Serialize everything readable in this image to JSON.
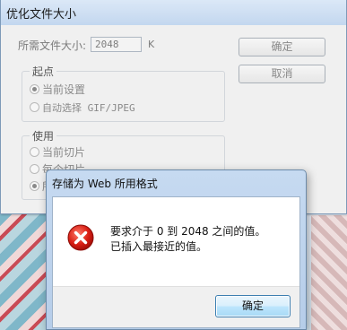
{
  "main_dialog": {
    "title": "优化文件大小",
    "size_label": "所需文件大小:",
    "size_value": "2048",
    "size_unit": "K",
    "ok_label": "确定",
    "cancel_label": "取消",
    "start_group": {
      "title": "起点",
      "options": [
        "当前设置",
        "自动选择 GIF/JPEG"
      ],
      "selected": 0
    },
    "use_group": {
      "title": "使用",
      "options": [
        "当前切片",
        "每个切片",
        "所"
      ],
      "selected": 2
    }
  },
  "error_dialog": {
    "title": "存储为 Web 所用格式",
    "message_line1": "要求介于 0 到 2048 之间的值。",
    "message_line2": "已插入最接近的值。",
    "ok_label": "确定",
    "icon": "error-icon"
  }
}
